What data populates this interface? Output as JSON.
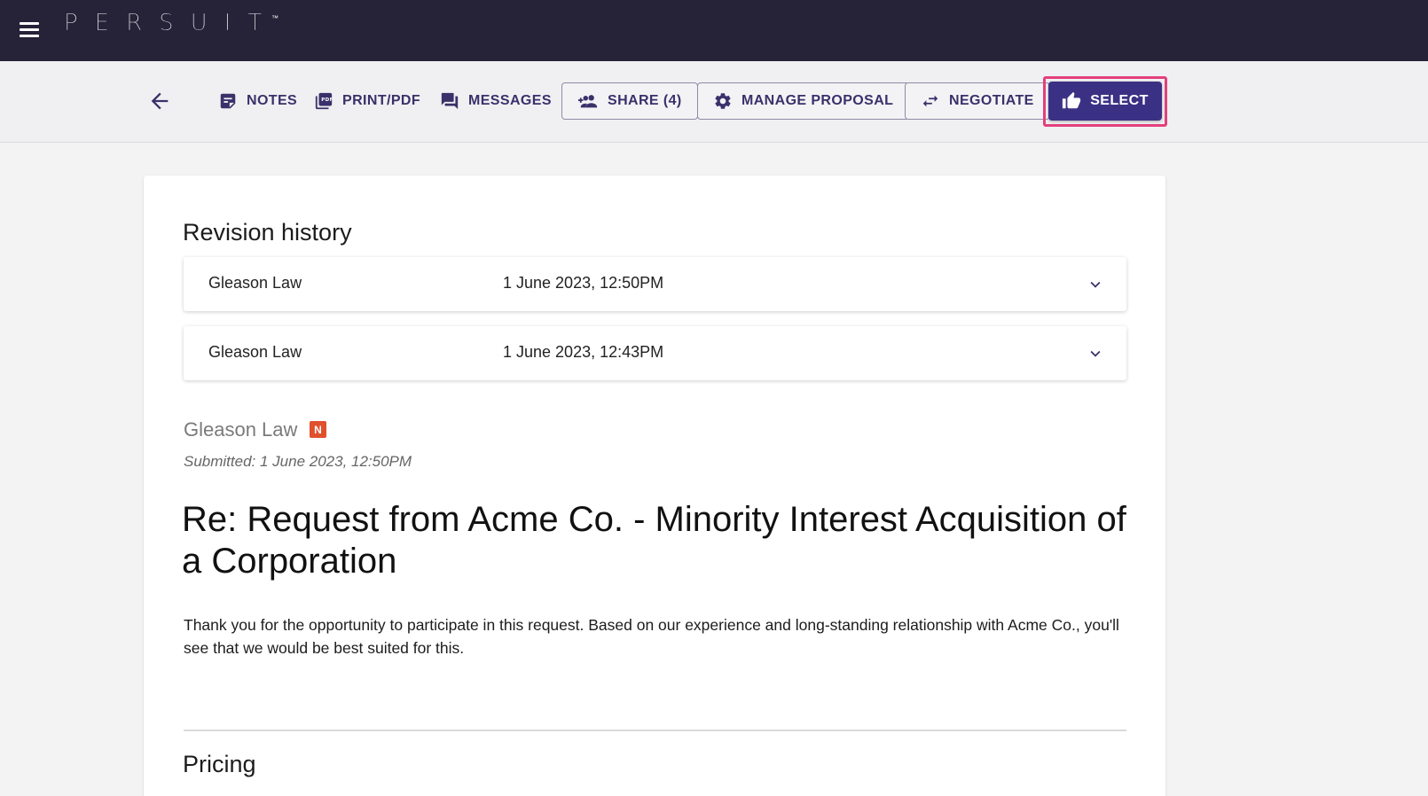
{
  "app": {
    "logo_text": "PERSUIT",
    "logo_tm": "™",
    "menu_icon": "hamburger-menu-icon"
  },
  "toolbar": {
    "back_icon": "arrow-left-icon",
    "notes_label": "NOTES",
    "print_label": "PRINT/PDF",
    "messages_label": "MESSAGES",
    "share_label": "SHARE (4)",
    "manage_label": "MANAGE PROPOSAL",
    "negotiate_label": "NEGOTIATE",
    "select_label": "SELECT",
    "highlight_color": "#e3407b",
    "accent_color": "#3b3184"
  },
  "revision_history": {
    "title": "Revision history",
    "rows": [
      {
        "firm": "Gleason Law",
        "date": "1 June 2023, 12:50PM"
      },
      {
        "firm": "Gleason Law",
        "date": "1 June 2023, 12:43PM"
      }
    ]
  },
  "proposal": {
    "firm": "Gleason Law",
    "badge": "N",
    "badge_color": "#e0502c",
    "submitted": "Submitted: 1 June 2023, 12:50PM",
    "title": "Re: Request from Acme Co. - Minority Interest Acquisition of a Corporation",
    "body": "Thank you for the opportunity to participate in this request. Based on our experience and long-standing relationship with Acme Co., you'll see that we would be best suited for this."
  },
  "pricing": {
    "title": "Pricing"
  }
}
